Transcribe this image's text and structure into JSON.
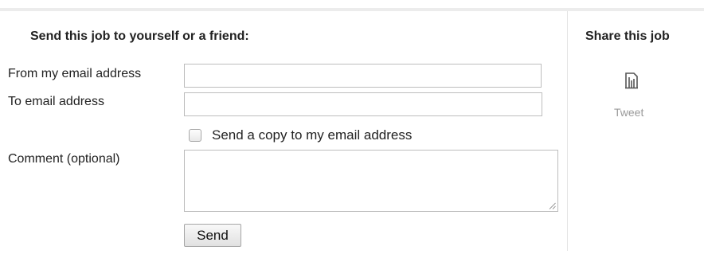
{
  "form": {
    "heading": "Send this job to yourself or a friend:",
    "from_label": "From my email address",
    "from_value": "",
    "to_label": "To email address",
    "to_value": "",
    "copy_label": "Send a copy to my email address",
    "copy_checked": false,
    "comment_label": "Comment (optional)",
    "comment_value": "",
    "send_label": "Send"
  },
  "share": {
    "heading": "Share this job",
    "icon": "broken-image-icon",
    "tweet_label": "Tweet"
  }
}
